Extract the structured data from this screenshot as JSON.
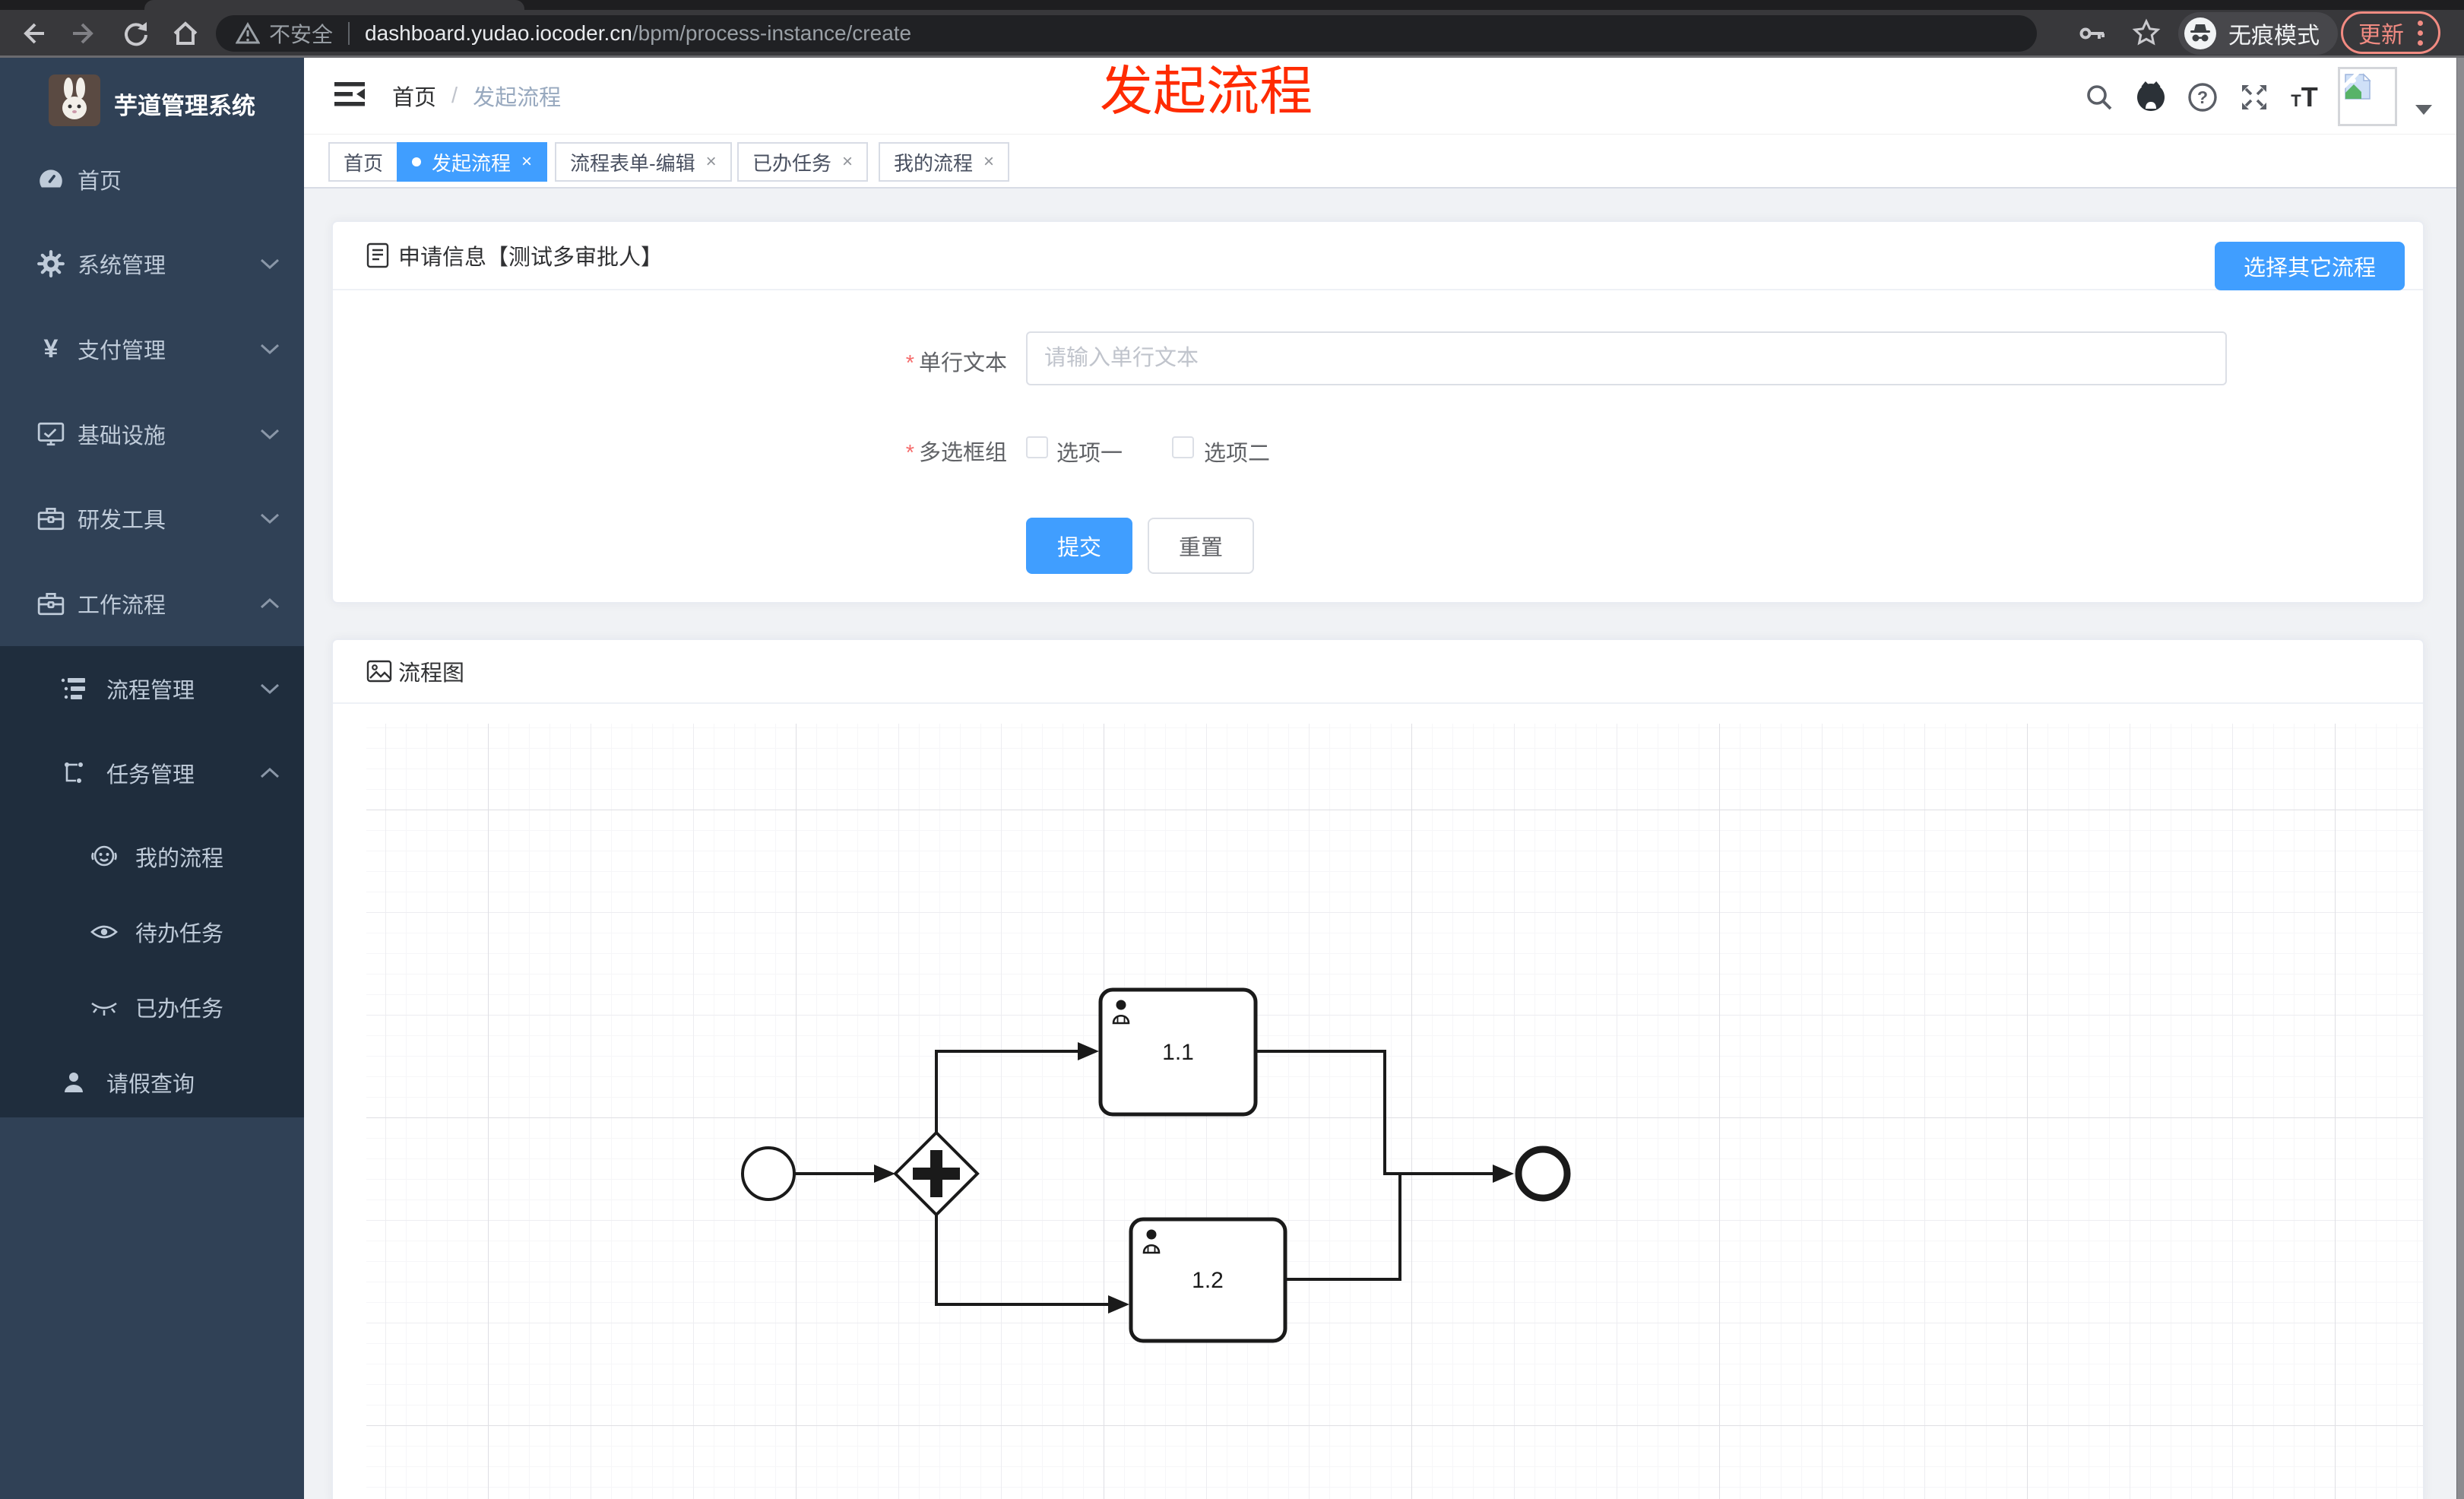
{
  "browser": {
    "security_label": "不安全",
    "url_host": "dashboard.yudao.iocoder.cn",
    "url_path": "/bpm/process-instance/create",
    "incognito_label": "无痕模式",
    "update_label": "更新"
  },
  "annotation": {
    "text": "发起流程"
  },
  "sidebar": {
    "app_title": "芋道管理系统",
    "items": [
      {
        "label": "首页",
        "icon": "dashboard-icon"
      },
      {
        "label": "系统管理",
        "icon": "gear-icon"
      },
      {
        "label": "支付管理",
        "icon": "yen-icon"
      },
      {
        "label": "基础设施",
        "icon": "monitor-icon"
      },
      {
        "label": "研发工具",
        "icon": "toolbox-icon"
      },
      {
        "label": "工作流程",
        "icon": "toolbox-icon"
      }
    ],
    "submenu": [
      {
        "label": "流程管理",
        "icon": "tree-table-icon"
      },
      {
        "label": "任务管理",
        "icon": "flow-icon"
      },
      {
        "label": "我的流程",
        "icon": "face-icon"
      },
      {
        "label": "待办任务",
        "icon": "eye-open-icon"
      },
      {
        "label": "已办任务",
        "icon": "eye-closed-icon"
      },
      {
        "label": "请假查询",
        "icon": "person-icon"
      }
    ]
  },
  "navbar": {
    "breadcrumb_home": "首页",
    "breadcrumb_sep": "/",
    "breadcrumb_current": "发起流程"
  },
  "tabs": [
    {
      "label": "首页"
    },
    {
      "label": "发起流程"
    },
    {
      "label": "流程表单-编辑"
    },
    {
      "label": "已办任务"
    },
    {
      "label": "我的流程"
    }
  ],
  "tab_close_glyph": "×",
  "form_card": {
    "title": "申请信息【测试多审批人】",
    "action_button": "选择其它流程",
    "field_text_label": "单行文本",
    "field_text_placeholder": "请输入单行文本",
    "field_checkbox_label": "多选框组",
    "checkbox_options": [
      "选项一",
      "选项二"
    ],
    "submit_label": "提交",
    "reset_label": "重置"
  },
  "diagram_card": {
    "title": "流程图",
    "tasks": [
      {
        "label": "1.1"
      },
      {
        "label": "1.2"
      }
    ]
  },
  "colors": {
    "accent": "#409eff",
    "sidebar_bg": "#304156",
    "submenu_bg": "#1f2d3d",
    "annotation_red": "#ff2b00",
    "update_salmon": "#f28b82"
  }
}
